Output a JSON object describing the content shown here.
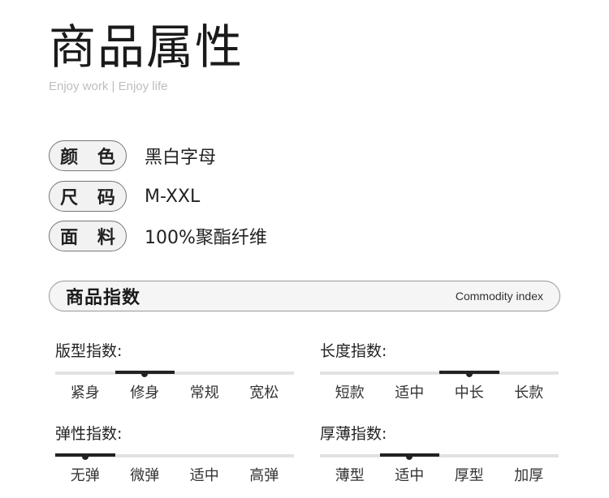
{
  "header": {
    "title": "商品属性",
    "subtitle": "Enjoy work | Enjoy life"
  },
  "attributes": [
    {
      "label": "颜 色",
      "value": "黑白字母"
    },
    {
      "label": "尺 码",
      "value": "M-XXL"
    },
    {
      "label": "面 料",
      "value": "100%聚酯纤维"
    }
  ],
  "index": {
    "title": "商品指数",
    "subtitle": "Commodity index"
  },
  "groups": [
    {
      "label": "版型指数:",
      "options": [
        "紧身",
        "修身",
        "常规",
        "宽松"
      ],
      "selected_index": 1
    },
    {
      "label": "长度指数:",
      "options": [
        "短款",
        "适中",
        "中长",
        "长款"
      ],
      "selected_index": 2
    },
    {
      "label": "弹性指数:",
      "options": [
        "无弹",
        "微弹",
        "适中",
        "高弹"
      ],
      "selected_index": 0
    },
    {
      "label": "厚薄指数:",
      "options": [
        "薄型",
        "适中",
        "厚型",
        "加厚"
      ],
      "selected_index": 1
    }
  ]
}
